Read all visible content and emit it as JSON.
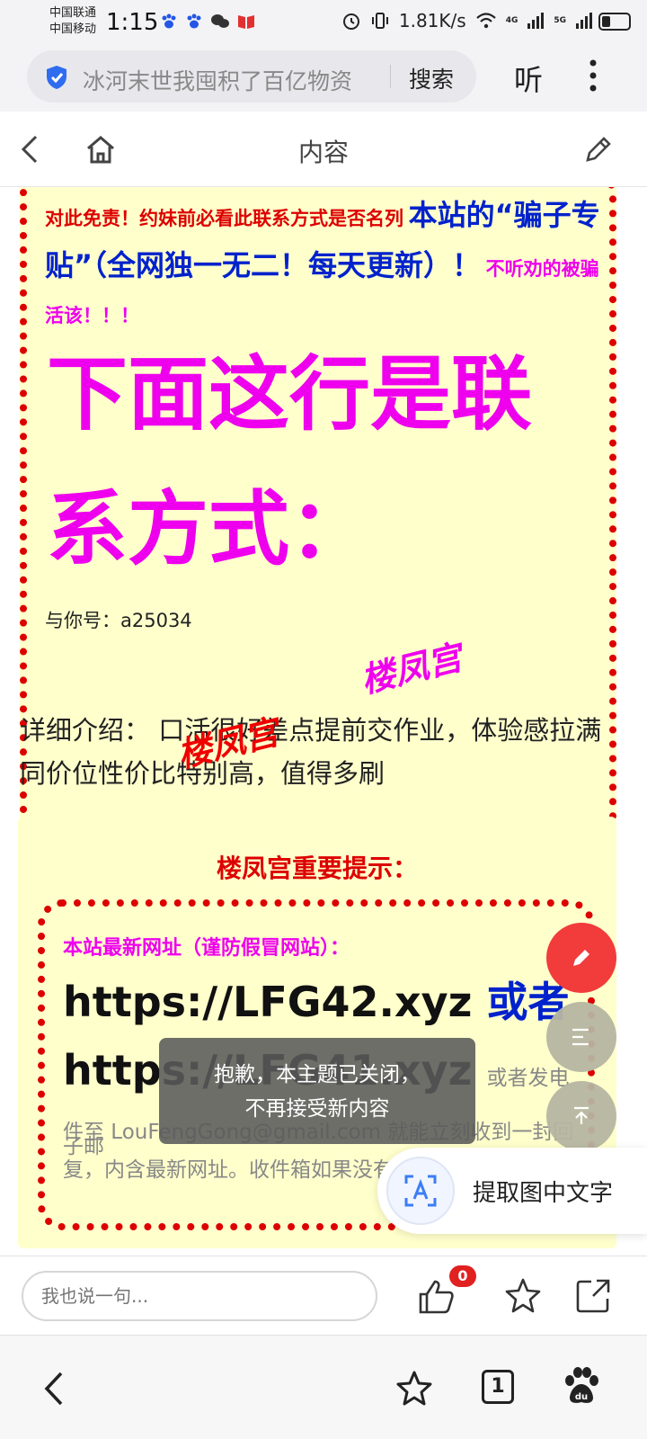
{
  "status_bar": {
    "carrier1": "中国联通",
    "carrier2": "中国移动",
    "time": "1:15",
    "net_speed": "1.81K/s",
    "net_4g": "4G",
    "net_5g": "5G"
  },
  "address_bar": {
    "title": "冰河末世我囤积了百亿物资",
    "search_label": "搜索",
    "listen_label": "听"
  },
  "page_header": {
    "title": "内容"
  },
  "content": {
    "box1": {
      "red_line": "对此免责！约妹前必看此联系方式是否名列",
      "blue_line": "本站的“骗子专贴”（全网独一无二！每天更新）！",
      "magenta_line": "不听劝的被骗活该！！！",
      "big_heading": "下面这行是联系方式：",
      "contact_id": "与你号：a25034"
    },
    "watermark": "楼凤宫",
    "detail_text": "详细介绍：  口活很好差点提前交作业，体验感拉满同价位性价比特别高，值得多刷",
    "notice_box": {
      "title": "楼凤宫重要提示：",
      "warning": "本站最新网址（谨防假冒网站）：",
      "url1": "https://LFG42.xyz",
      "or_text": "或者",
      "url2": "https://LFG41.xyz",
      "small_after_url2": "或者发电子邮",
      "tail_text": "件至 LouFengGong@gmail.com 就能立刻收到一封回复，内含最新网址。收件箱如果没有，去垃圾箱找。"
    }
  },
  "toast": {
    "line1": "抱歉，本主题已关闭，",
    "line2": "不再接受新内容"
  },
  "extract_button": {
    "label": "提取图中文字"
  },
  "comment_bar": {
    "placeholder": "我也说一句...",
    "like_count": "0"
  },
  "bottom_nav": {
    "tab_count": "1"
  },
  "colors": {
    "dotted_border": "#dd0000",
    "magenta": "#ee00ee",
    "blue": "#0022cc",
    "box_bg": "#ffffcc",
    "fab_red": "#f23b3b"
  }
}
